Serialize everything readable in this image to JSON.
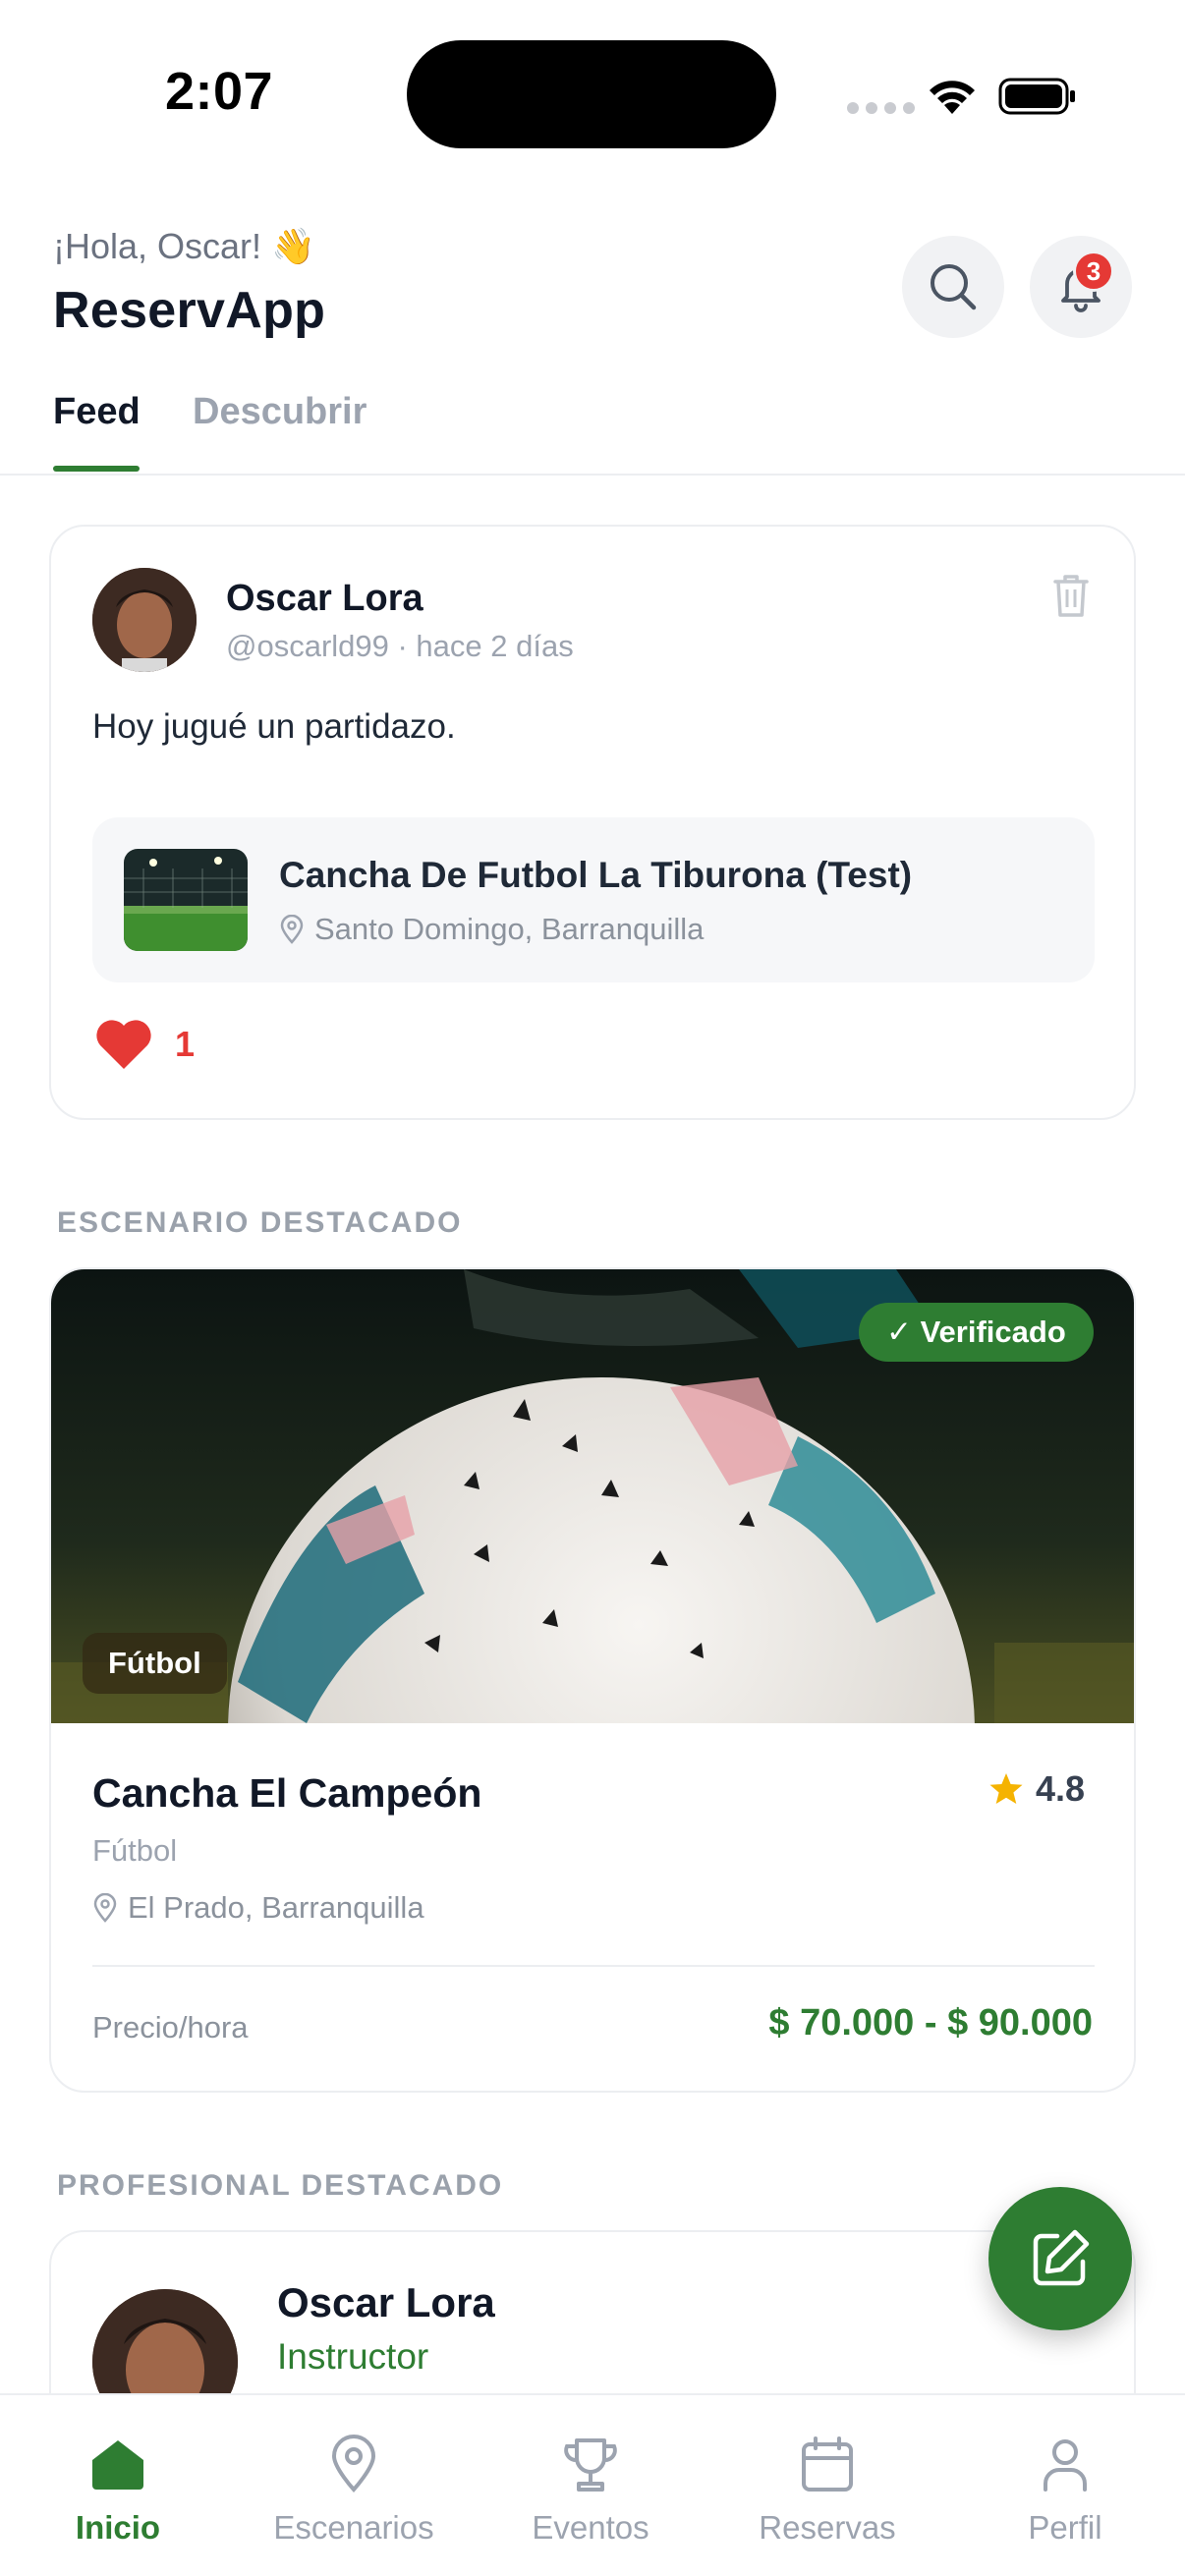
{
  "status_bar": {
    "time": "2:07"
  },
  "header": {
    "greeting": "¡Hola, Oscar! 👋",
    "title": "ReservApp",
    "notification_count": "3"
  },
  "tabs": [
    {
      "label": "Feed",
      "active": true
    },
    {
      "label": "Descubrir",
      "active": false
    }
  ],
  "post": {
    "author": "Oscar Lora",
    "meta": "@oscarld99 · hace 2 días",
    "text": "Hoy jugué un partidazo.",
    "venue": {
      "name": "Cancha De Futbol La Tiburona (Test)",
      "location": "Santo Domingo, Barranquilla"
    },
    "likes": "1"
  },
  "featured_venue": {
    "section_label": "ESCENARIO DESTACADO",
    "verified_label": "✓ Verificado",
    "sport_badge": "Fútbol",
    "name": "Cancha El Campeón",
    "rating": "4.8",
    "sport": "Fútbol",
    "location": "El Prado, Barranquilla",
    "price_label": "Precio/hora",
    "price": "$ 70.000 - $ 90.000"
  },
  "featured_pro": {
    "section_label": "PROFESIONAL DESTACADO",
    "name": "Oscar Lora",
    "role": "Instructor"
  },
  "bottom_nav": [
    {
      "label": "Inicio",
      "icon": "home-icon",
      "active": true
    },
    {
      "label": "Escenarios",
      "icon": "map-pin-icon",
      "active": false
    },
    {
      "label": "Eventos",
      "icon": "trophy-icon",
      "active": false
    },
    {
      "label": "Reservas",
      "icon": "calendar-icon",
      "active": false
    },
    {
      "label": "Perfil",
      "icon": "user-icon",
      "active": false
    }
  ],
  "colors": {
    "accent": "#2e7d32",
    "like": "#e53935",
    "rating_star": "#f5b301"
  }
}
